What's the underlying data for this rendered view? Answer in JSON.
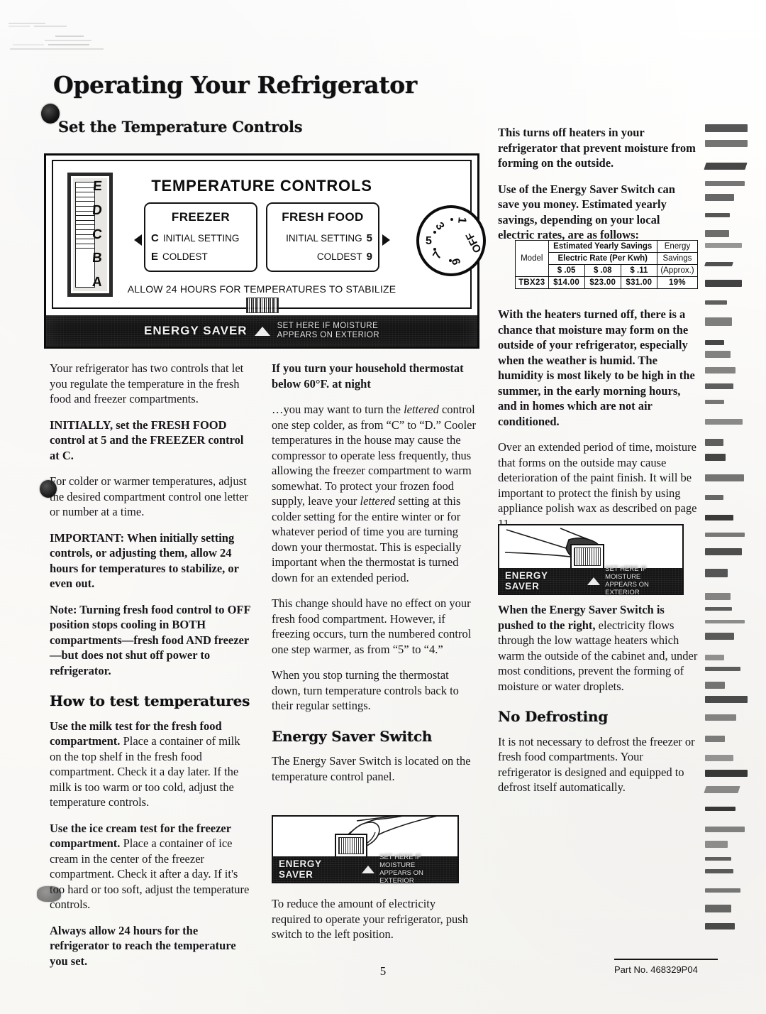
{
  "document": {
    "title": "Operating Your Refrigerator",
    "subhead": "Set the Temperature Controls",
    "page_number": "5",
    "part_number": "Part No. 468329P04"
  },
  "figure_panel": {
    "heading": "TEMPERATURE CONTROLS",
    "slider_letters": [
      "E",
      "D",
      "C",
      "B",
      "A"
    ],
    "freezer_box": {
      "title": "FREEZER",
      "row1_letter": "C",
      "row1_label": "INITIAL SETTING",
      "row2_letter": "E",
      "row2_label": "COLDEST"
    },
    "fresh_food_box": {
      "title": "FRESH FOOD",
      "row1_label": "INITIAL SETTING",
      "row1_value": "5",
      "row2_label": "COLDEST",
      "row2_value": "9"
    },
    "dial_marks": [
      "1",
      "3",
      "5",
      "7",
      "9",
      "OFF"
    ],
    "stabilize_note": "ALLOW 24 HOURS FOR TEMPERATURES TO STABILIZE",
    "energy_saver_label": "ENERGY SAVER",
    "energy_saver_sub_line1": "SET HERE IF MOISTURE",
    "energy_saver_sub_line2": "APPEARS ON EXTERIOR"
  },
  "left_column": {
    "p1": "Your refrigerator has two controls that let you regulate the temperature in the fresh food and freezer compartments.",
    "p2": "INITIALLY, set the FRESH FOOD control at 5 and the FREEZER control at C.",
    "p3": "For colder or warmer temperatures, adjust the desired compartment control one letter or number at a time.",
    "p4": "IMPORTANT: When initially setting controls, or adjusting them, allow 24 hours for temperatures to stabilize, or even out.",
    "p5": "Note: Turning fresh food control to OFF position stops cooling in BOTH compartments—fresh food AND freezer—but does not shut off power to refrigerator.",
    "heading_test": "How to test temperatures",
    "p6_bold": "Use the milk test for the fresh food compartment.",
    "p6_rest": " Place a container of milk on the top shelf in the fresh food compartment. Check it a day later. If the milk is too warm or too cold, adjust the temperature controls.",
    "p7_bold": "Use the ice cream test for the freezer compartment.",
    "p7_rest": " Place a container of ice cream in the center of the freezer compartment. Check it after a day. If it's too hard or too soft, adjust the temperature controls.",
    "p8": "Always allow 24 hours for the refrigerator to reach the temperature you set."
  },
  "middle_column": {
    "heading_thermostat": "If you turn your household thermostat below 60°F. at night",
    "p1_a": "…you may want to turn the ",
    "p1_ital1": "lettered",
    "p1_b": " control one step colder, as from “C” to “D.” Cooler temperatures in the house may cause the compressor to operate less frequently, thus allowing the freezer compartment to warm somewhat. To protect your frozen food supply, leave your ",
    "p1_ital2": "lettered",
    "p1_c": " setting at this colder setting for the entire winter or for whatever period of time you are turning down your thermostat. This is especially important when the thermostat is turned down for an extended period.",
    "p2": "This change should have no effect on your fresh food compartment. However, if freezing occurs, turn the numbered control one step warmer, as from “5” to “4.”",
    "p3": "When you stop turning the thermostat down, turn temperature controls back to their regular settings.",
    "heading_energy_saver": "Energy Saver Switch",
    "p4": "The Energy Saver Switch is located on the temperature control panel.",
    "p5": "To reduce the amount of electricity required to operate your refrigerator, push switch to the left position."
  },
  "right_column": {
    "p1": "This turns off heaters in your refrigerator that prevent moisture from forming on the outside.",
    "p2": "Use of the Energy Saver Switch can save you money. Estimated yearly savings, depending on your local electric rates, are as follows:",
    "p3": "With the heaters turned off, there is a chance that moisture may form on the outside of your refrigerator, especially when the weather is humid. The humidity is most likely to be high in the summer, in the early morning hours, and in homes which are not air conditioned.",
    "p4": "Over an extended period of time, moisture that forms on the outside may cause deterioration of the paint finish. It will be important to protect the finish by using appliance polish wax as described on page 11.",
    "p5_bold": "When the Energy Saver Switch is pushed to the right,",
    "p5_rest": " electricity flows through the low wattage heaters which warm the outside of the cabinet and, under most conditions, prevent the forming of moisture or water droplets.",
    "heading_no_defrosting": "No Defrosting",
    "p6": "It is not necessary to defrost the freezer or fresh food compartments. Your refrigerator is designed and equipped to defrost itself automatically."
  },
  "savings_table": {
    "col_model": "Model",
    "group_header": "Estimated Yearly Savings",
    "rate_header": "Electric Rate (Per Kwh)",
    "energy_savings_l1": "Energy",
    "energy_savings_l2": "Savings",
    "energy_savings_l3": "(Approx.)",
    "rates": [
      "$    .05",
      "$    .08",
      "$    .11"
    ],
    "rows": [
      {
        "model": "TBX23",
        "values": [
          "$14.00",
          "$23.00",
          "$31.00"
        ],
        "savings_pct": "19%"
      }
    ]
  },
  "switch_figures": {
    "label": "ENERGY SAVER",
    "sub_line1": "SET HERE IF MOISTURE",
    "sub_line2": "APPEARS ON EXTERIOR"
  }
}
